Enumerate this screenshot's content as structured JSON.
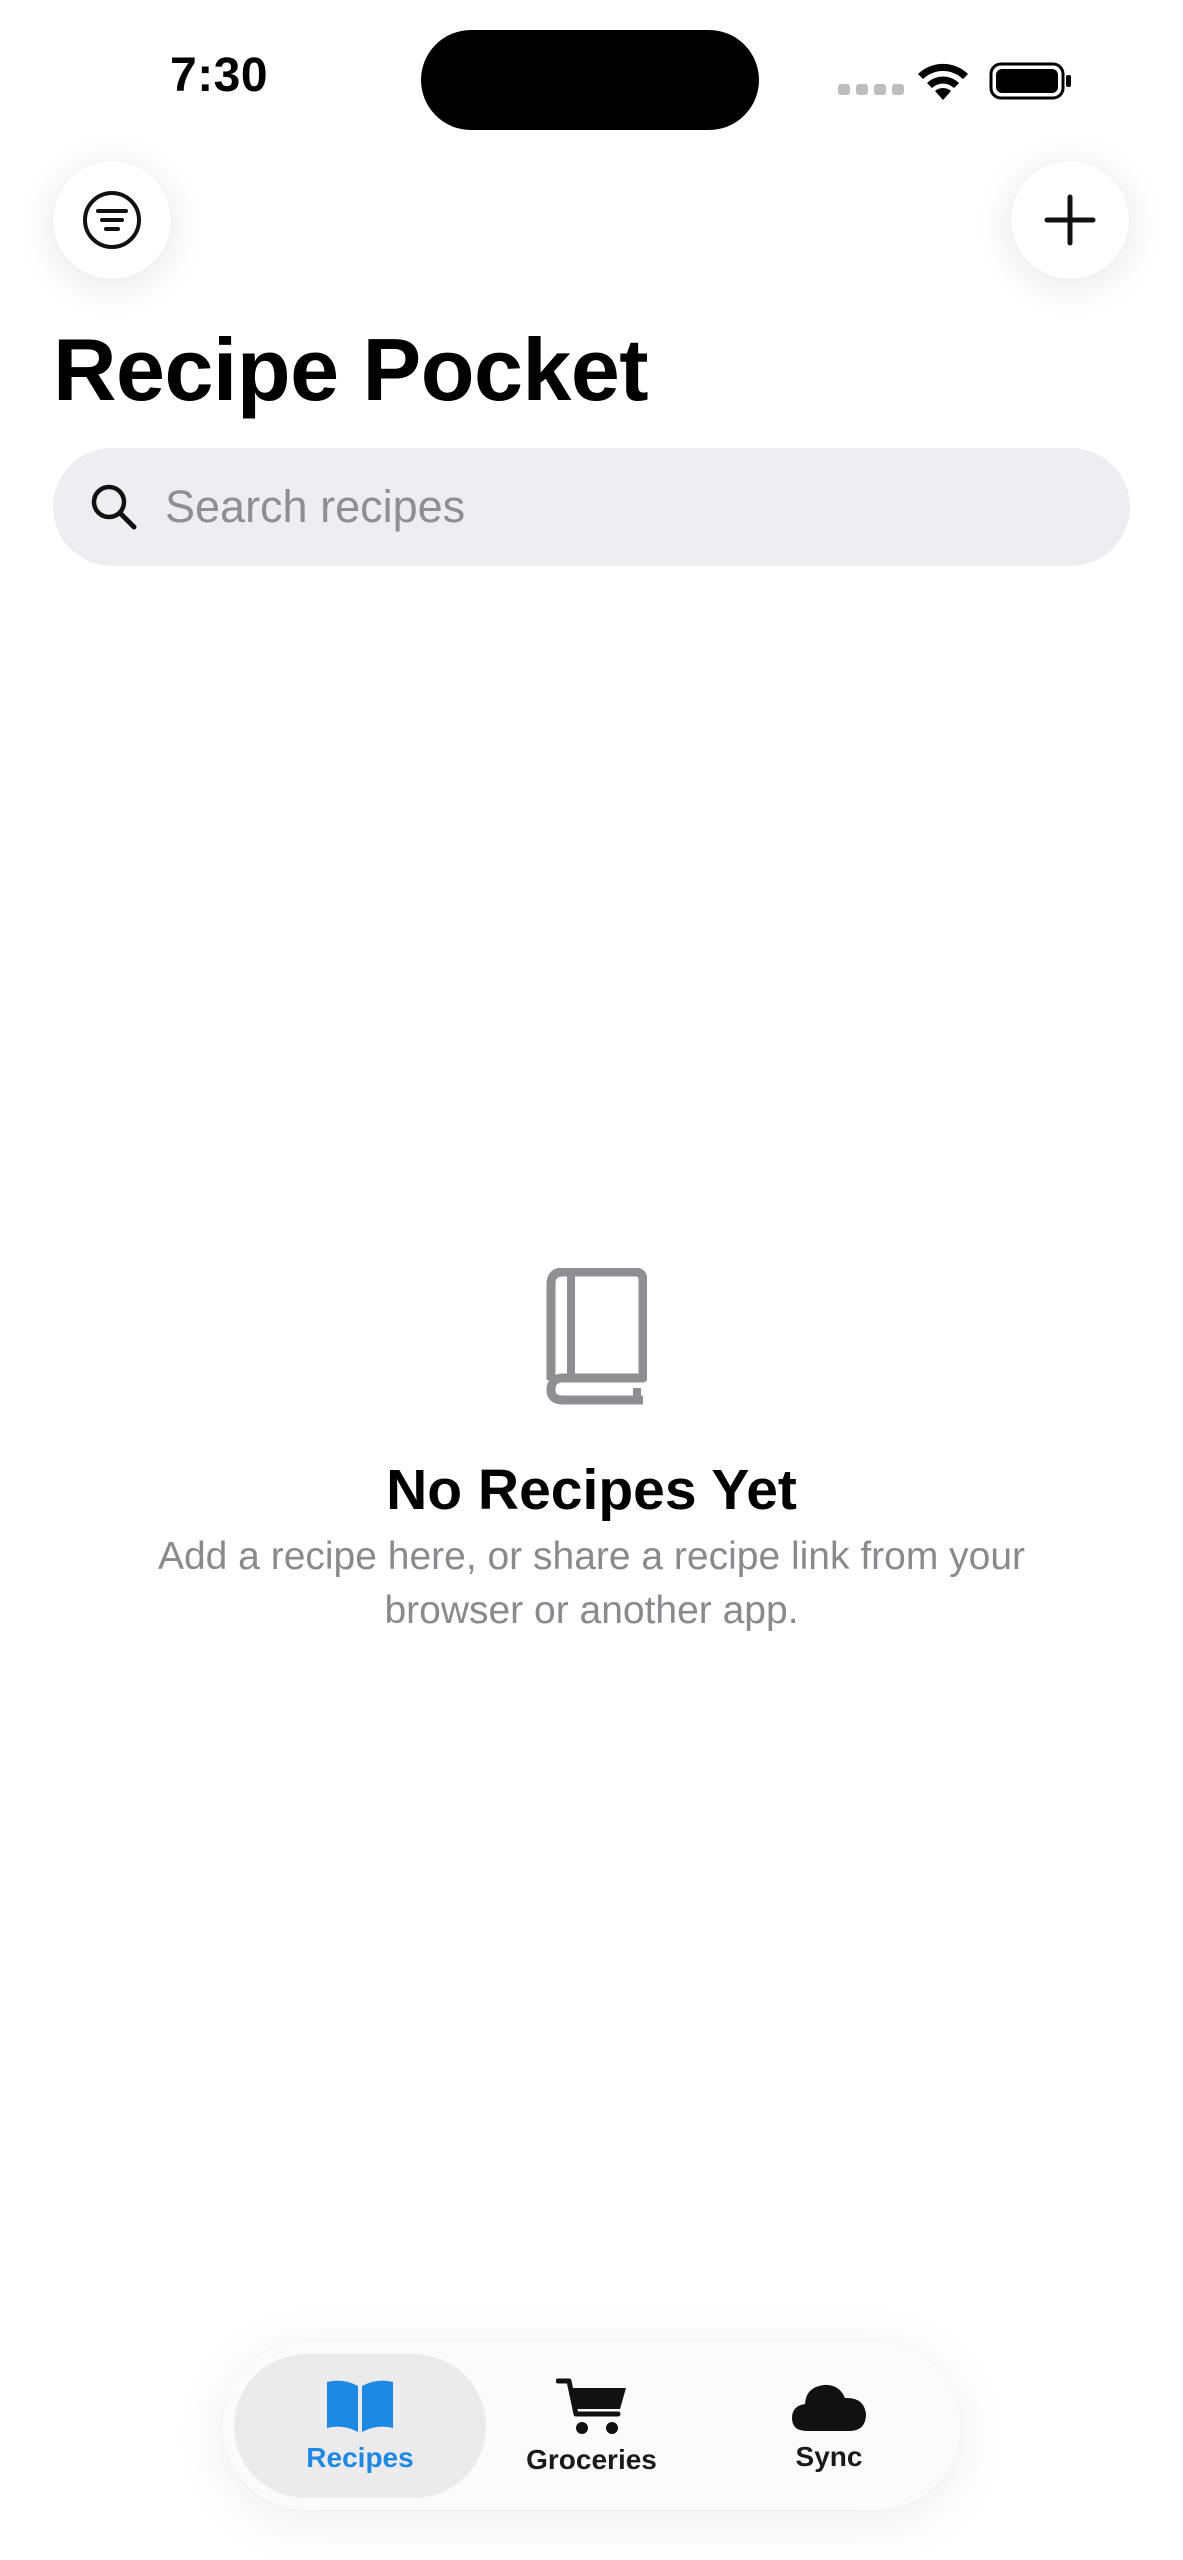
{
  "status_bar": {
    "time": "7:30"
  },
  "header": {
    "title": "Recipe Pocket",
    "filter_icon": "line-3-horizontal-decrease-circle-icon",
    "add_icon": "plus-icon"
  },
  "search": {
    "placeholder": "Search recipes",
    "value": "",
    "icon": "magnifying-glass-icon"
  },
  "empty_state": {
    "icon": "book-icon",
    "title": "No Recipes Yet",
    "message": "Add a recipe here, or share a recipe link from your browser or another app."
  },
  "tab_bar": {
    "tabs": [
      {
        "label": "Recipes",
        "icon": "open-book-icon",
        "selected": true
      },
      {
        "label": "Groceries",
        "icon": "cart-icon",
        "selected": false
      },
      {
        "label": "Sync",
        "icon": "cloud-icon",
        "selected": false
      }
    ]
  },
  "colors": {
    "accent": "#1e88e5",
    "search_background": "#eeeef0",
    "secondary_text": "#8a8a8e",
    "empty_icon": "#8e8e93"
  }
}
